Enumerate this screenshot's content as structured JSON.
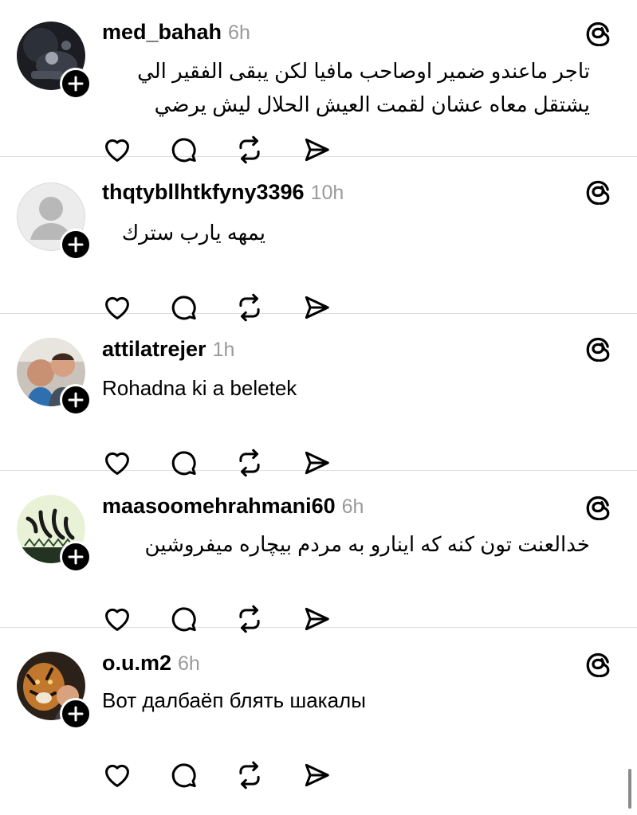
{
  "posts": [
    {
      "username": "med_bahah",
      "time": "6h",
      "text": "تاجر ماعندو ضمير اوصاحب مافيا لكن يبقى الفقير الي يشتقل معاه عشان لقمت العيش الحلال ليش يرضي",
      "direction": "rtl",
      "avatar_icon": "dark-photo-avatar"
    },
    {
      "username": "thqtybllhtkfyny3396",
      "time": "10h",
      "text": "يمهه يارب سترك",
      "direction": "rtl",
      "avatar_icon": "default-avatar"
    },
    {
      "username": "attilatrejer",
      "time": "1h",
      "text": "Rohadna ki a beletek",
      "direction": "ltr",
      "avatar_icon": "selfie-photo-avatar"
    },
    {
      "username": "maasoomehrahmani60",
      "time": "6h",
      "text": "خدالعنت تون کنه که اینارو  به مردم بیچاره میفروشین",
      "direction": "rtl",
      "avatar_icon": "calligraphy-avatar"
    },
    {
      "username": "o.u.m2",
      "time": "6h",
      "text": "Вот далбаёп блять шакалы",
      "direction": "ltr",
      "avatar_icon": "tiger-photo-avatar"
    }
  ],
  "actions": [
    "heart-icon",
    "comment-icon",
    "repost-icon",
    "share-icon"
  ],
  "header_icon": "threads-icon",
  "colors": {
    "text": "#000000",
    "timestamp": "#9a9a9a",
    "divider": "#dedede",
    "badge": "#000000"
  }
}
